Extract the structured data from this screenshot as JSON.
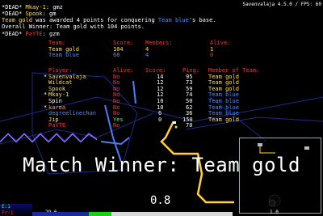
{
  "header": {
    "top_right": "Savenvalaja 4.5.0 / FPS: 60"
  },
  "chat": [
    {
      "prefix": "*DEAD*",
      "name": "Mkay-1",
      "msg": "gmz"
    },
    {
      "prefix": "*DEAD*",
      "name": "Spook",
      "msg": "gm"
    },
    {
      "team": "Team gold",
      "rest1": " was awarded 4 points for conquering ",
      "team2": "Team blue",
      "rest2": "'s base."
    },
    {
      "line": "Overall Winner: Team gold with 104 points."
    },
    {
      "prefix": "*DEAD*",
      "name": "PaYTE",
      "msg": "gzm"
    }
  ],
  "teams_table": {
    "headers": {
      "team": "Team:",
      "score": "Score:",
      "members": "Members:",
      "alive": "Alive:"
    },
    "rows": [
      {
        "team": "Team gold",
        "score": "104",
        "members": "4",
        "alive": "1"
      },
      {
        "team": "Team blue",
        "score": "68",
        "members": "4",
        "alive": "0"
      }
    ]
  },
  "players_table": {
    "headers": {
      "player": "Player:",
      "alive": "Alive:",
      "score": "Score:",
      "ping": "Ping:",
      "team": "Member of Team:"
    },
    "rows": [
      {
        "star": "*",
        "player": "Savenvalaja",
        "alive": "No",
        "score": "14",
        "ping": "95",
        "team": "Team gold"
      },
      {
        "star": "",
        "player": "Wildcat",
        "alive": "No",
        "score": "12",
        "ping": "73",
        "team": "Team gold"
      },
      {
        "star": "",
        "player": "Spook",
        "alive": "No",
        "score": "12",
        "ping": "59",
        "team": "Team gold"
      },
      {
        "star": "*",
        "player": "Mkay-1",
        "alive": "No",
        "score": "12",
        "ping": "74",
        "team": "Team blue"
      },
      {
        "star": "",
        "player": "Spin",
        "alive": "No",
        "score": "10",
        "ping": "50",
        "team": "Team blue"
      },
      {
        "star": "*",
        "player": "karma",
        "alive": "No",
        "score": "10",
        "ping": "62",
        "team": "Team blue"
      },
      {
        "star": "",
        "player": "degreelinechan",
        "alive": "No",
        "score": "6",
        "ping": "36",
        "team": "Team blue"
      },
      {
        "star": "",
        "player": "Jip",
        "alive": "Yes",
        "score": "0",
        "ping": "150",
        "team": "Team gold"
      },
      {
        "star": "",
        "player": "PaYTE",
        "alive": "No",
        "score": "",
        "ping": "70",
        "team": ""
      }
    ]
  },
  "banner": "Match Winner: Team gold",
  "hud": {
    "countdown": "0.8",
    "left_top": "E:1",
    "left_bottom": "Fr:1",
    "speed": "29.6",
    "minimap_scale": "1.0"
  },
  "colors": {
    "gold": "#ffe040",
    "blue": "#4a8cff",
    "red": "#ff3030",
    "green": "#40ff40",
    "wall": "#ffd23c"
  }
}
